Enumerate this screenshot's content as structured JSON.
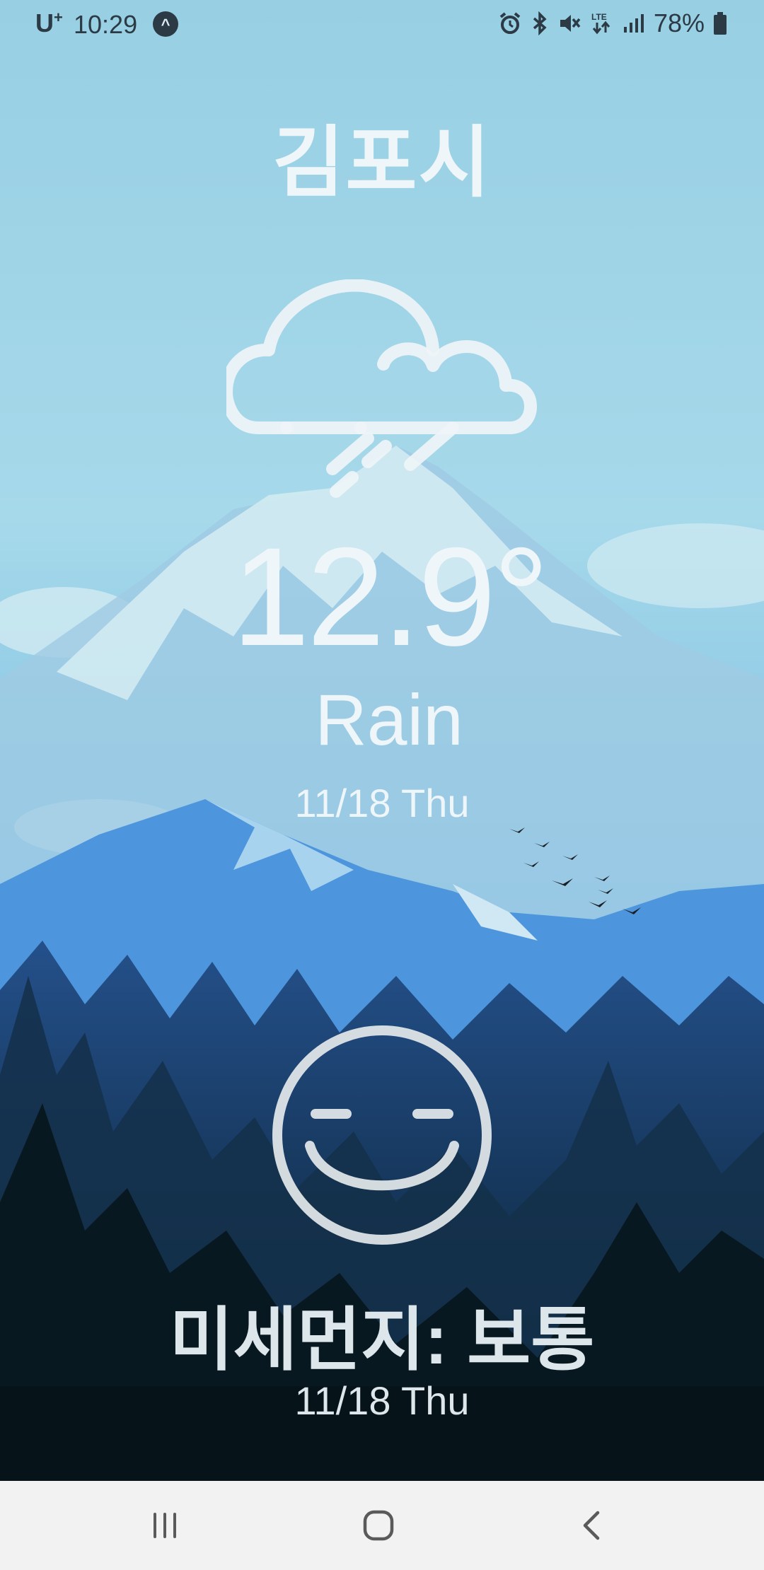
{
  "status_bar": {
    "carrier": "U",
    "carrier_sup": "+",
    "time": "10:29",
    "nav_indicator": "^",
    "icons": [
      "alarm-icon",
      "bluetooth-icon",
      "mute-icon",
      "lte-icon",
      "signal-icon"
    ],
    "network": "LTE",
    "battery": "78%"
  },
  "weather": {
    "city": "김포시",
    "icon": "cloud-rain-icon",
    "temperature": "12.9°",
    "condition": "Rain",
    "date": "11/18 Thu"
  },
  "dust": {
    "icon": "smiley-face-icon",
    "status": "미세먼지: 보통",
    "date": "11/18 Thu"
  },
  "navigation": {
    "buttons": [
      "recent-apps-icon",
      "home-icon",
      "back-icon"
    ]
  },
  "colors": {
    "sky": "#a6d9ea",
    "mountain_far": "#c7e7ee",
    "mountain_mid": "#4b95df",
    "forest_dark": "#1b3e63",
    "forest_black": "#0a1c24",
    "text": "#eef6fa",
    "nav_bar": "#f2f2f2"
  }
}
